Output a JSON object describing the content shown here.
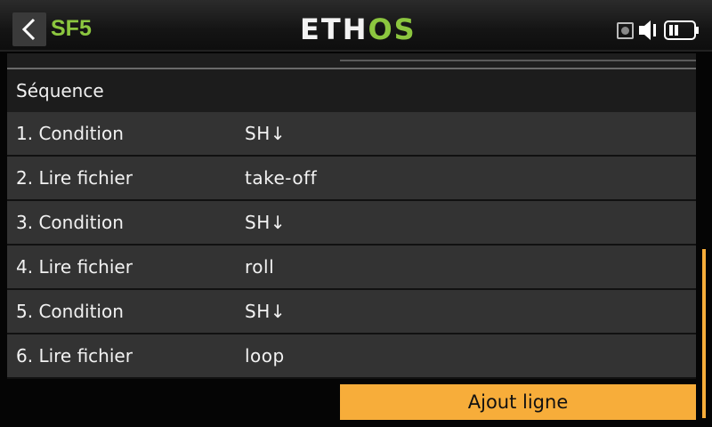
{
  "header": {
    "title": "SF5",
    "logo_main": "ETH",
    "logo_accent": "OS",
    "icons": [
      "back-chevron-icon",
      "record-icon",
      "speaker-icon",
      "battery-icon"
    ]
  },
  "section": {
    "title": "Séquence"
  },
  "rows": [
    {
      "label": "1. Condition",
      "value": "SH↓"
    },
    {
      "label": "2. Lire fichier",
      "value": "take-off"
    },
    {
      "label": "3. Condition",
      "value": "SH↓"
    },
    {
      "label": "4. Lire fichier",
      "value": "roll"
    },
    {
      "label": "5. Condition",
      "value": "SH↓"
    },
    {
      "label": "6. Lire fichier",
      "value": "loop"
    }
  ],
  "add_button": {
    "label": "Ajout ligne"
  },
  "colors": {
    "accent_green": "#8cc63f",
    "accent_orange": "#f7ad3a",
    "row_bg": "#333333"
  }
}
